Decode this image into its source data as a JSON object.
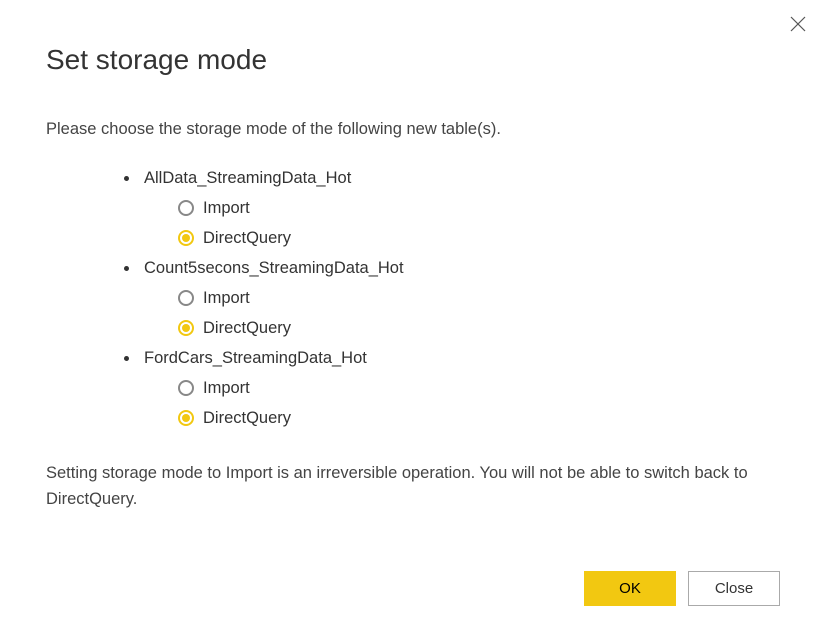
{
  "dialog": {
    "title": "Set storage mode",
    "intro": "Please choose the storage mode of the following new table(s).",
    "tables": [
      {
        "name": "AllData_StreamingData_Hot",
        "options": [
          {
            "label": "Import",
            "selected": false
          },
          {
            "label": "DirectQuery",
            "selected": true
          }
        ]
      },
      {
        "name": "Count5secons_StreamingData_Hot",
        "options": [
          {
            "label": "Import",
            "selected": false
          },
          {
            "label": "DirectQuery",
            "selected": true
          }
        ]
      },
      {
        "name": "FordCars_StreamingData_Hot",
        "options": [
          {
            "label": "Import",
            "selected": false
          },
          {
            "label": "DirectQuery",
            "selected": true
          }
        ]
      }
    ],
    "warning": "Setting storage mode to Import is an irreversible operation. You will not be able to switch back to DirectQuery.",
    "ok_label": "OK",
    "close_label": "Close"
  }
}
